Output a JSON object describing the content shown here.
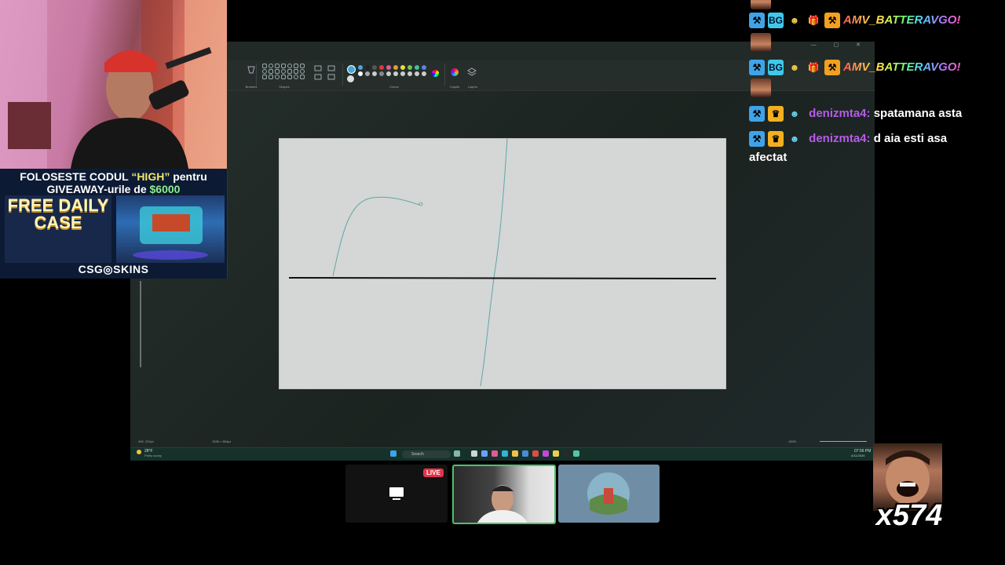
{
  "sponsor": {
    "line1_prefix": "FOLOSESTE CODUL ",
    "line1_code": "“HIGH”",
    "line1_suffix": " pentru",
    "line2_prefix": "GIVEAWAY-urile de ",
    "line2_amount": "$6000",
    "daily_case": "FREE DAILY CASE",
    "brand": "CSG◎SKINS"
  },
  "paint": {
    "toolbar_groups": [
      "Brushes",
      "Shapes",
      "Colors",
      "Copilot",
      "Layers"
    ],
    "palette": [
      "#4aa5d8",
      "#222222",
      "#555555",
      "#e03a3a",
      "#e05a9a",
      "#e0a030",
      "#e8e040",
      "#70c850",
      "#40c0a0",
      "#6080e0",
      "#ffffff",
      "#aaaaaa",
      "#cccccc",
      "#888888",
      "#cccccc",
      "#cccccc",
      "#cccccc",
      "#cccccc",
      "#cccccc",
      "#cccccc"
    ],
    "status_left": "455, 232px",
    "status_size": "1536 × 864px",
    "zoom": "100%"
  },
  "taskbar": {
    "weather": "28°F",
    "weather_desc": "Partly sunny",
    "search": "Search",
    "time": "07:56 PM",
    "date": "4/11/2026"
  },
  "chat": {
    "top_user": "AMV_BATTERAVGO!",
    "messages": [
      {
        "user": "AMV_BATTERAVGO!",
        "text": ""
      },
      {
        "user": "denizmta4:",
        "text": "spatamana asta"
      },
      {
        "user": "denizmta4:",
        "text": "d aia esti asa"
      }
    ],
    "wrap": "afectat"
  },
  "stream": {
    "live_label": "LIVE",
    "reaction_count": "x574"
  },
  "colors": {
    "accent_green": "#49c46d",
    "live_red": "#e6334a",
    "chat_user": "#b65ce8"
  }
}
